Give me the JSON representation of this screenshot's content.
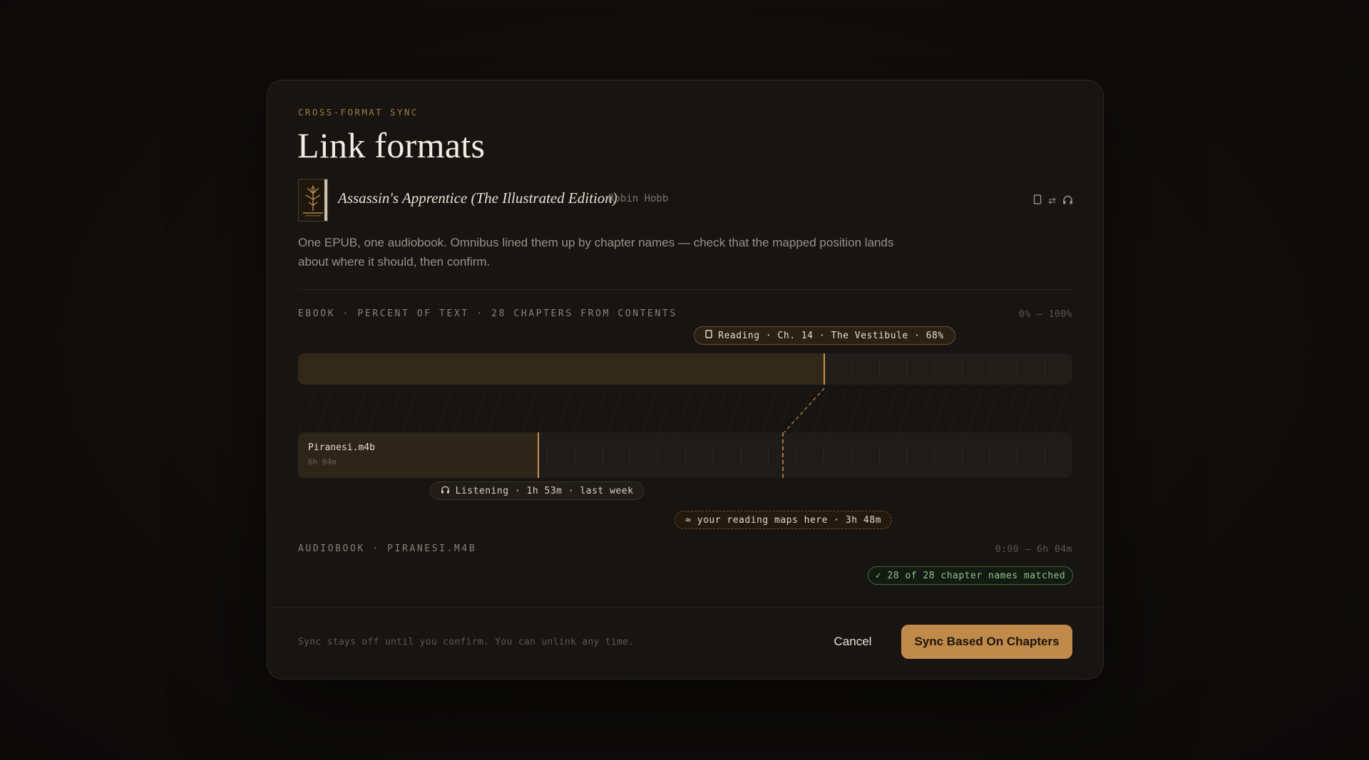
{
  "header": {
    "eyebrow": "CROSS-FORMAT SYNC",
    "title": "Link formats"
  },
  "book": {
    "title": "Assassin's Apprentice (The Illustrated Edition)",
    "author": "Robin Hobb",
    "format_icons": [
      "ebook-icon",
      "swap-arrows-icon",
      "headphones-icon"
    ],
    "link_glyph": "⇄"
  },
  "description": "One EPUB, one audiobook. Omnibus lined them up by chapter names — check that the mapped position lands about where it should, then confirm.",
  "ebook": {
    "label": "EBOOK · PERCENT OF TEXT · 28 CHAPTERS FROM CONTENTS",
    "range": "0% — 100%",
    "progress_fraction": 0.68,
    "reading_pill": "Reading · Ch. 14 · The Vestibule · 68%"
  },
  "audiobook": {
    "label": "AUDIOBOOK · PIRANESI.M4B",
    "range": "0:00 — 6h 04m",
    "file_name": "Piranesi.m4b",
    "duration": "6h 04m",
    "listen_fraction": 0.31,
    "mapped_fraction": 0.626,
    "listening_pill": "Listening · 1h 53m · last week",
    "maps_pill": "≈ your reading maps here · 3h 48m"
  },
  "match_badge": "✓ 28 of 28 chapter names matched",
  "footer": {
    "note": "Sync stays off until you confirm. You can unlink any time.",
    "cancel_label": "Cancel",
    "confirm_label": "Sync Based On Chapters"
  },
  "colors": {
    "accent": "#c08a4a",
    "success": "#8ec48a",
    "background": "#171411"
  }
}
